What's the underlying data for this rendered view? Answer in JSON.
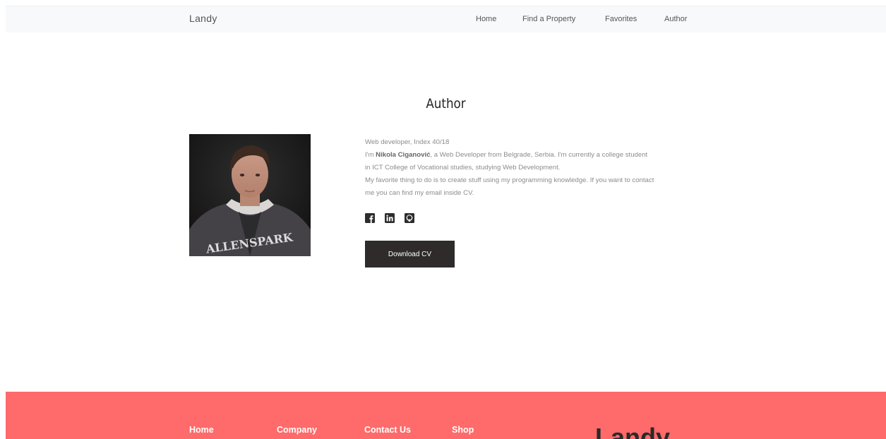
{
  "navbar": {
    "brand": "Landy",
    "links": [
      "Home",
      "Find a Property",
      "Favorites",
      "Author"
    ]
  },
  "page": {
    "title": "Author"
  },
  "author": {
    "subtitle": "Web developer, Index 40/18",
    "intro_prefix": "I'm ",
    "name": "Nikola Ciganović",
    "intro_suffix": ", a Web Developer from Belgrade, Serbia. I'm currently a college student in ICT College of Vocational studies, studying Web Development.",
    "paragraph2": "My favorite thing to do is to create stuff using my programming knowledge. If you want to contact me you can find my email inside CV.",
    "socials": [
      "facebook-icon",
      "linkedin-icon",
      "github-icon"
    ],
    "photo_shirt_text": "ALLENSPARK",
    "download_label": "Download CV"
  },
  "footer": {
    "links": [
      "Home",
      "Company",
      "Contact Us",
      "Shop"
    ],
    "logo": "Landy"
  },
  "colors": {
    "navbar_bg": "#f8f9fa",
    "footer_bg": "#ff6a6a",
    "button_bg": "#2f2b2b",
    "text_muted": "#8c8c8c"
  }
}
